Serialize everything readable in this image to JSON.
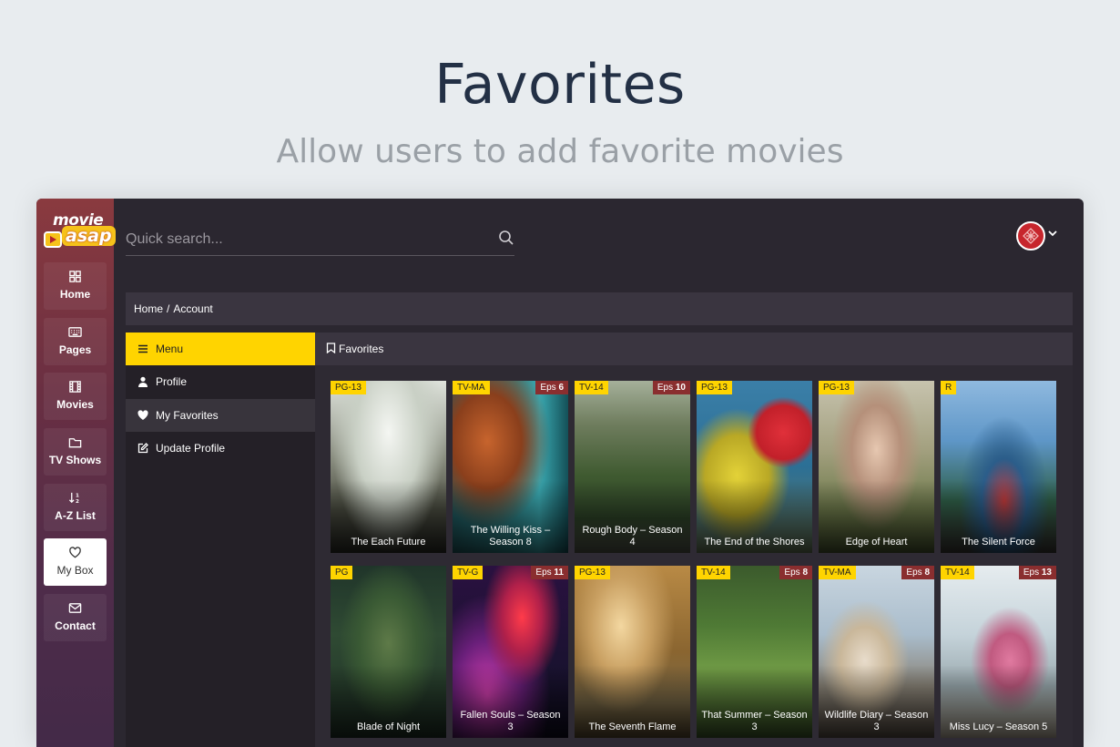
{
  "hero": {
    "title": "Favorites",
    "subtitle": "Allow users to add favorite movies"
  },
  "brand": {
    "logo_top": "movie",
    "logo_bottom": "asap"
  },
  "rail": [
    {
      "label": "Home",
      "icon": "grid-icon"
    },
    {
      "label": "Pages",
      "icon": "keyboard-icon"
    },
    {
      "label": "Movies",
      "icon": "film-icon"
    },
    {
      "label": "TV Shows",
      "icon": "folder-icon"
    },
    {
      "label": "A-Z List",
      "icon": "sort-icon"
    },
    {
      "label": "My Box",
      "icon": "heart-icon",
      "active": true
    },
    {
      "label": "Contact",
      "icon": "mail-icon"
    }
  ],
  "search": {
    "placeholder": "Quick search..."
  },
  "breadcrumb": {
    "home": "Home",
    "separator": "/",
    "current": "Account"
  },
  "side_menu": {
    "menu_label": "Menu",
    "items": [
      {
        "label": "Profile",
        "icon": "user-icon"
      },
      {
        "label": "My Favorites",
        "icon": "heart-icon",
        "selected": true
      },
      {
        "label": "Update Profile",
        "icon": "edit-icon"
      }
    ]
  },
  "favorites": {
    "heading": "Favorites",
    "cards": [
      {
        "rating": "PG-13",
        "eps_label": "",
        "eps_num": "",
        "title": "The Each Future"
      },
      {
        "rating": "TV-MA",
        "eps_label": "Eps",
        "eps_num": "6",
        "title": "The Willing Kiss – Season 8"
      },
      {
        "rating": "TV-14",
        "eps_label": "Eps",
        "eps_num": "10",
        "title": "Rough Body – Season 4"
      },
      {
        "rating": "PG-13",
        "eps_label": "",
        "eps_num": "",
        "title": "The End of the Shores"
      },
      {
        "rating": "PG-13",
        "eps_label": "",
        "eps_num": "",
        "title": "Edge of Heart"
      },
      {
        "rating": "R",
        "eps_label": "",
        "eps_num": "",
        "title": "The Silent Force"
      },
      {
        "rating": "PG",
        "eps_label": "",
        "eps_num": "",
        "title": "Blade of Night"
      },
      {
        "rating": "TV-G",
        "eps_label": "Eps",
        "eps_num": "11",
        "title": "Fallen Souls – Season 3"
      },
      {
        "rating": "PG-13",
        "eps_label": "",
        "eps_num": "",
        "title": "The Seventh Flame"
      },
      {
        "rating": "TV-14",
        "eps_label": "Eps",
        "eps_num": "8",
        "title": "That Summer – Season 3"
      },
      {
        "rating": "TV-MA",
        "eps_label": "Eps",
        "eps_num": "8",
        "title": "Wildlife Diary – Season 3"
      },
      {
        "rating": "TV-14",
        "eps_label": "Eps",
        "eps_num": "13",
        "title": "Miss Lucy – Season 5"
      }
    ]
  },
  "colors": {
    "accent_yellow": "#ffd400",
    "eps_badge": "#8a2e2f",
    "app_bg": "#2b2730",
    "panel_bg": "#3a3540"
  }
}
